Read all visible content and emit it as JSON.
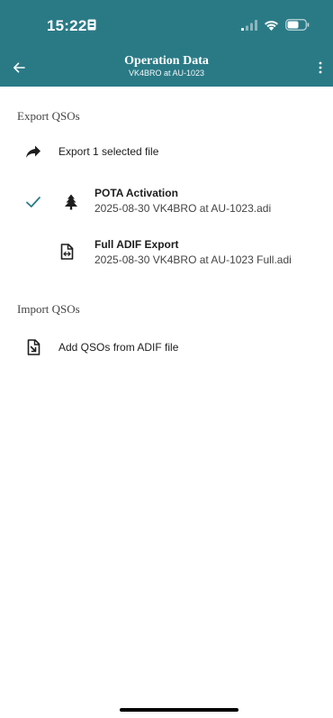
{
  "status_bar": {
    "time": "15:22"
  },
  "app_bar": {
    "title": "Operation Data",
    "subtitle": "VK4BRO at AU-1023"
  },
  "export_section": {
    "header": "Export QSOs",
    "export_action_label": "Export 1 selected file",
    "files": [
      {
        "title": "POTA Activation",
        "filename": "2025-08-30 VK4BRO at AU-1023.adi",
        "selected": true,
        "icon": "tree-icon"
      },
      {
        "title": "Full ADIF Export",
        "filename": "2025-08-30 VK4BRO at AU-1023 Full.adi",
        "selected": false,
        "icon": "file-export-icon"
      }
    ]
  },
  "import_section": {
    "header": "Import QSOs",
    "import_action_label": "Add QSOs from ADIF file"
  },
  "colors": {
    "primary": "#2a7a86",
    "check": "#2a7a86",
    "text": "#1d1d1d"
  }
}
